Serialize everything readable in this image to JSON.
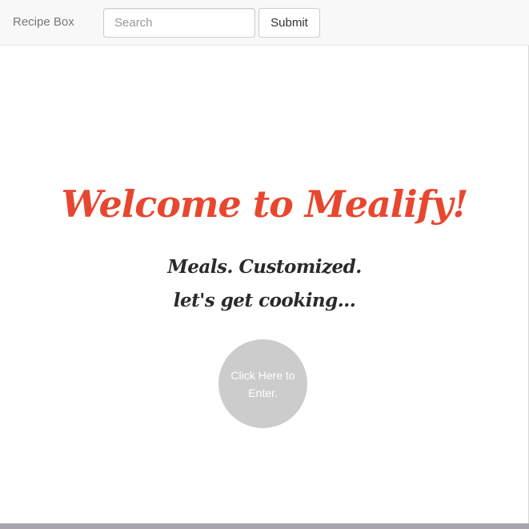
{
  "navbar": {
    "brand": "Recipe Box",
    "search_placeholder": "Search",
    "submit_label": "Submit"
  },
  "hero": {
    "title": "Welcome to Mealify!",
    "tagline_1": "Meals. Customized.",
    "tagline_2": "let's get cooking...",
    "enter_button": "Click Here to Enter."
  },
  "colors": {
    "title": "#e8472f",
    "tagline": "#2a2a2a",
    "enter_button_bg": "#cccccc",
    "navbar_bg": "#f8f8f8"
  }
}
